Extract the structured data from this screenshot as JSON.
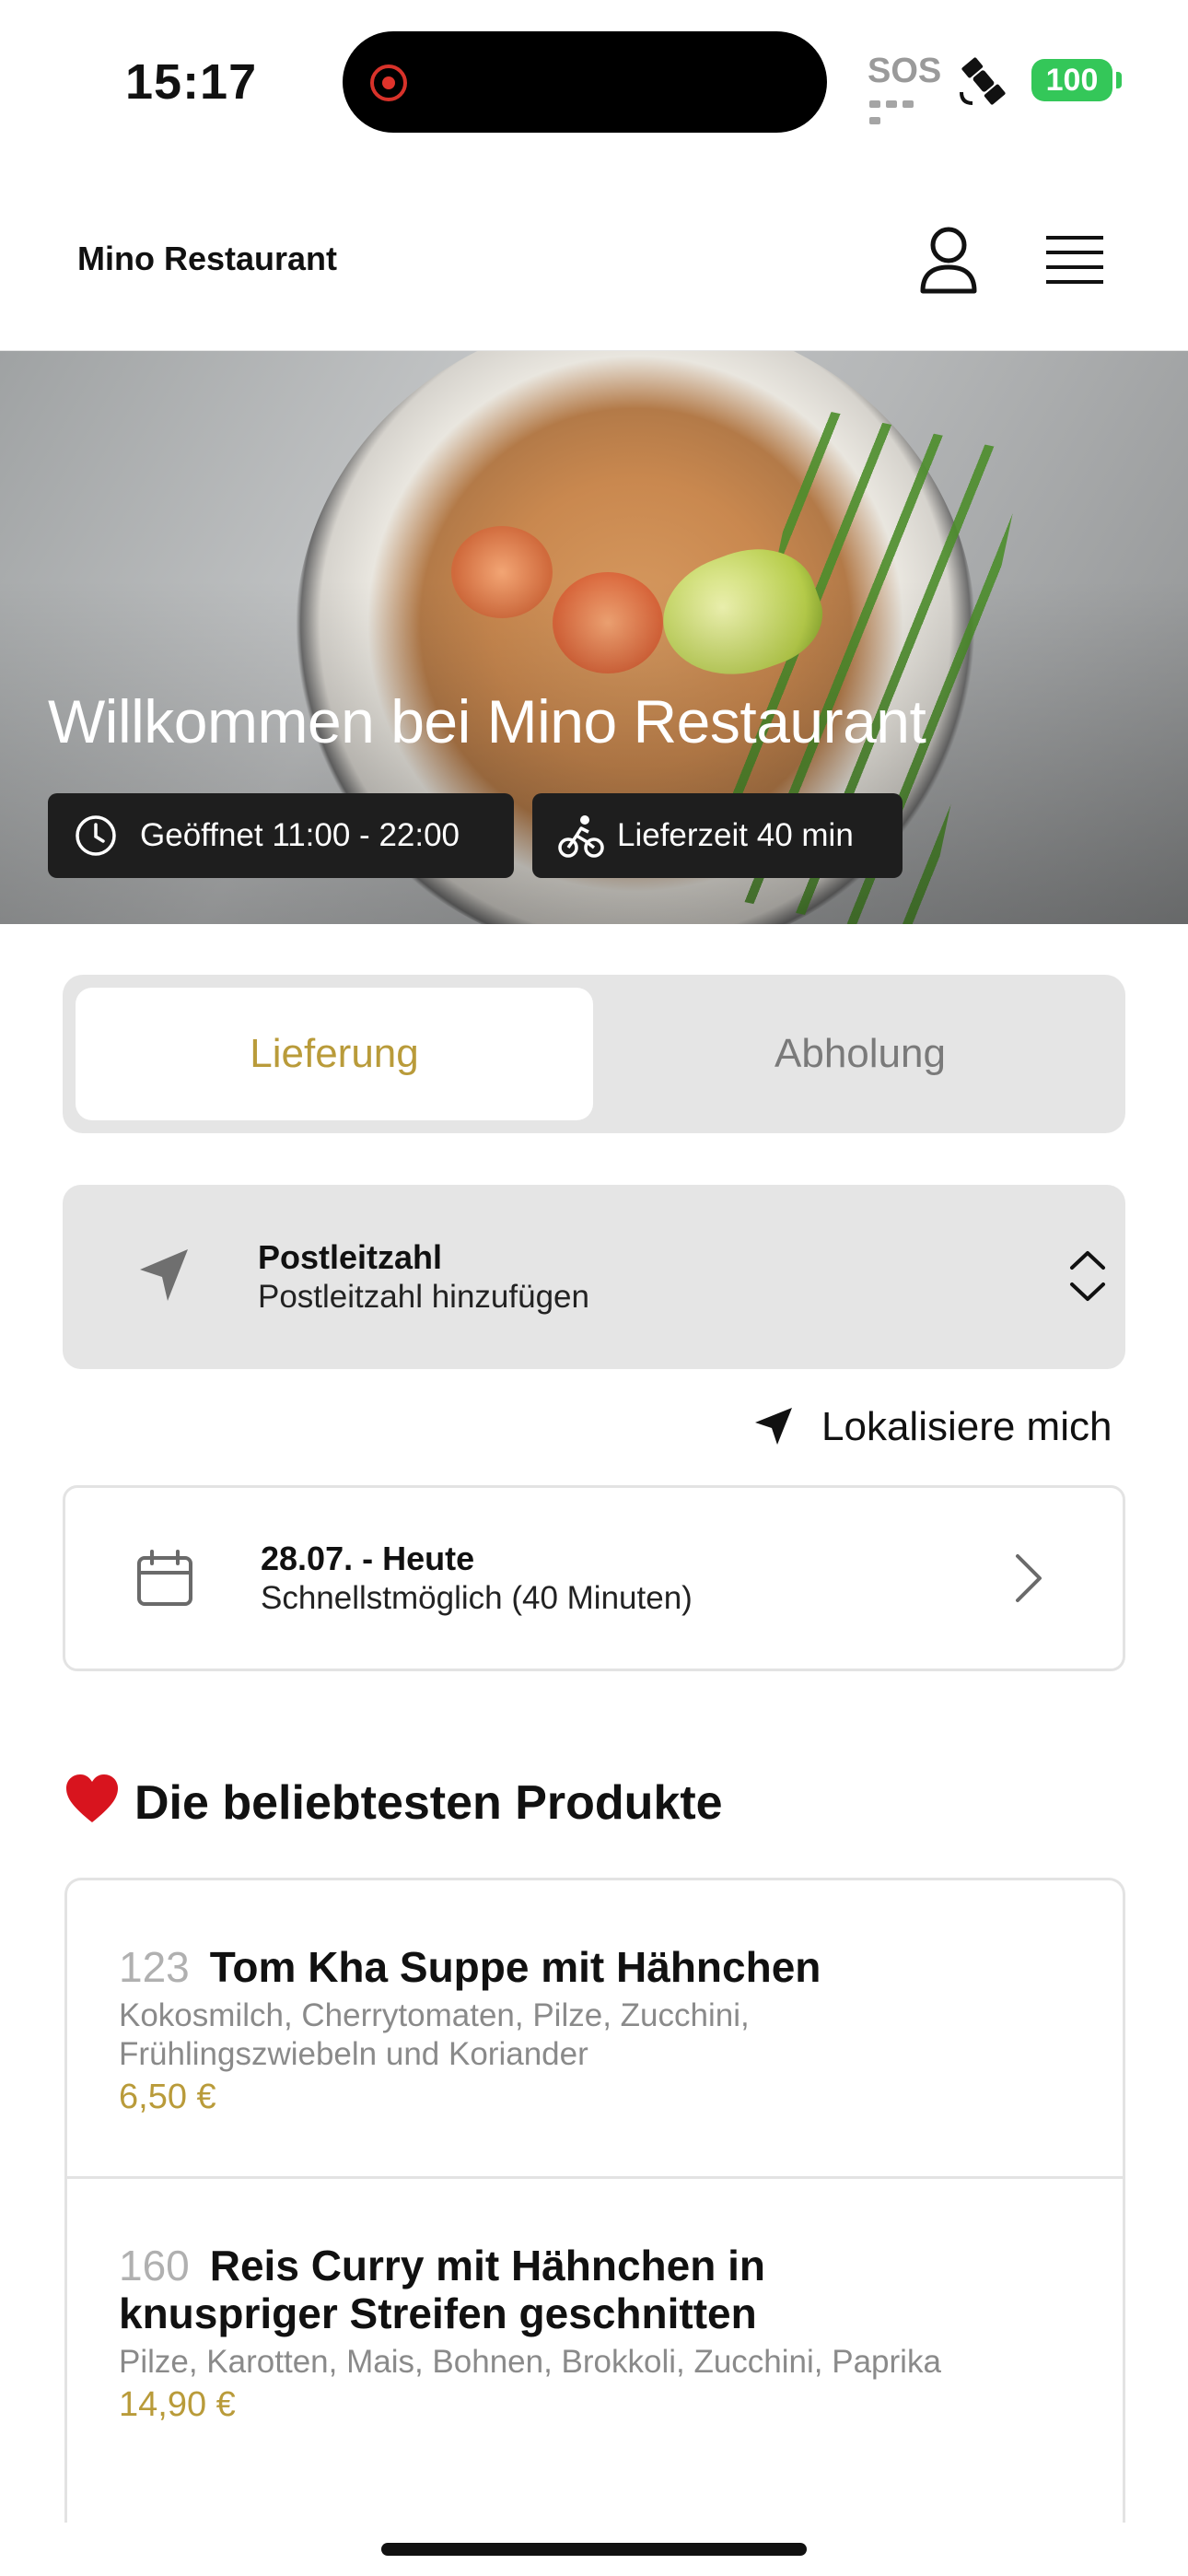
{
  "status_bar": {
    "time": "15:17",
    "sos": "SOS",
    "battery": "100"
  },
  "header": {
    "brand": "Mino Restaurant"
  },
  "hero": {
    "title": "Willkommen bei Mino Restaurant",
    "opening": "Geöffnet 11:00 - 22:00",
    "delivery_time": "Lieferzeit 40 min"
  },
  "order_mode": {
    "options": [
      "Lieferung",
      "Abholung"
    ],
    "selected": "Lieferung"
  },
  "postal": {
    "label": "Postleitzahl",
    "placeholder": "Postleitzahl hinzufügen"
  },
  "locate": {
    "label": "Lokalisiere mich"
  },
  "schedule": {
    "date": "28.07. - Heute",
    "time": "Schnellstmöglich (40 Minuten)"
  },
  "popular": {
    "title": "Die beliebtesten Produkte",
    "products": [
      {
        "number": "123",
        "name": "Tom Kha Suppe mit Hähnchen",
        "description": "Kokosmilch, Cherrytomaten, Pilze, Zucchini, Frühlingszwiebeln und Koriander",
        "price": "6,50 €"
      },
      {
        "number": "160",
        "name": "Reis Curry mit Hähnchen in knuspriger Streifen geschnitten",
        "description": "Pilze, Karotten, Mais, Bohnen, Brokkoli, Zucchini, Paprika",
        "price": "14,90 €"
      }
    ]
  },
  "colors": {
    "accent": "#b99b3a",
    "battery": "#34c759",
    "pill_bg": "#1e1e1e",
    "panel_bg": "#e5e5e5"
  },
  "icons": [
    "user-icon",
    "menu-icon",
    "clock-icon",
    "bike-icon",
    "navigation-arrow-icon",
    "updown-chevron-icon",
    "calendar-icon",
    "chevron-right-icon",
    "heart-icon"
  ]
}
